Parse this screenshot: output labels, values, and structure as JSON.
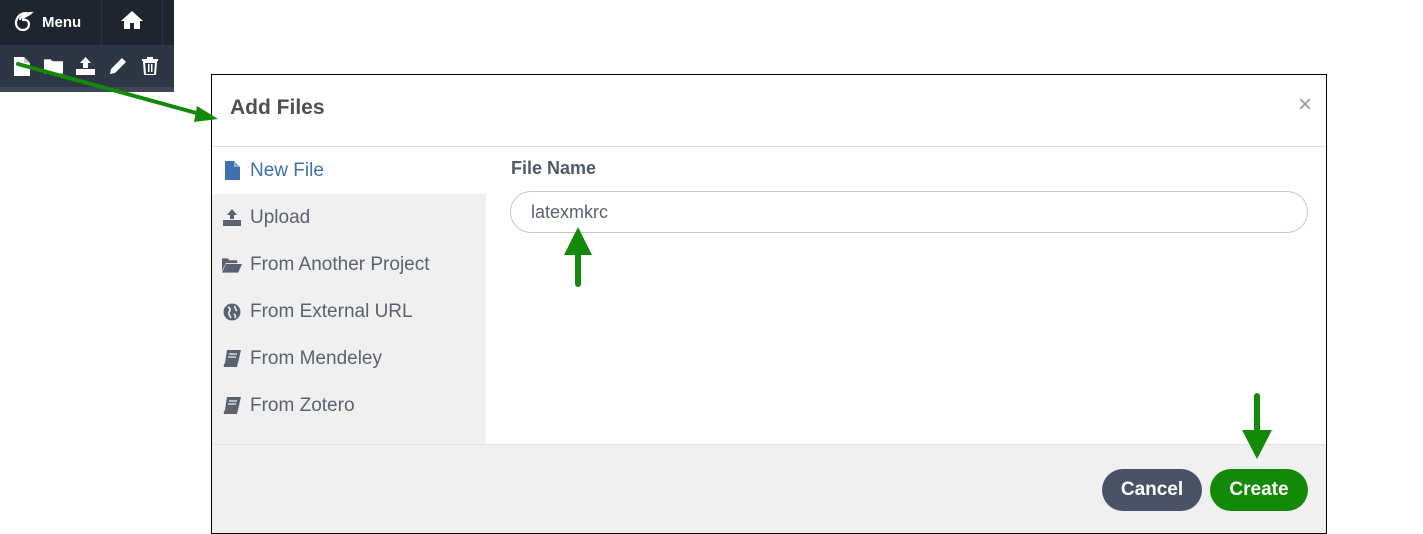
{
  "toolbar": {
    "menu_label": "Menu",
    "icons": [
      "overleaf-logo-icon",
      "home-icon",
      "new-file-icon",
      "new-folder-icon",
      "upload-icon",
      "rename-pencil-icon",
      "trash-icon"
    ]
  },
  "dialog": {
    "title": "Add Files",
    "close_symbol": "×",
    "sidebar": {
      "items": [
        {
          "label": "New File",
          "icon": "file-icon",
          "active": true
        },
        {
          "label": "Upload",
          "icon": "upload-icon"
        },
        {
          "label": "From Another Project",
          "icon": "folder-open-icon"
        },
        {
          "label": "From External URL",
          "icon": "globe-icon"
        },
        {
          "label": "From Mendeley",
          "icon": "book-icon"
        },
        {
          "label": "From Zotero",
          "icon": "book-icon"
        }
      ]
    },
    "form": {
      "file_name_label": "File Name",
      "file_name_value": "latexmkrc"
    },
    "footer": {
      "cancel_label": "Cancel",
      "create_label": "Create"
    }
  },
  "colors": {
    "accent_blue": "#3e70b2",
    "create_green": "#138a07",
    "cancel_slate": "#495365",
    "annotation_arrow": "#138a07"
  }
}
